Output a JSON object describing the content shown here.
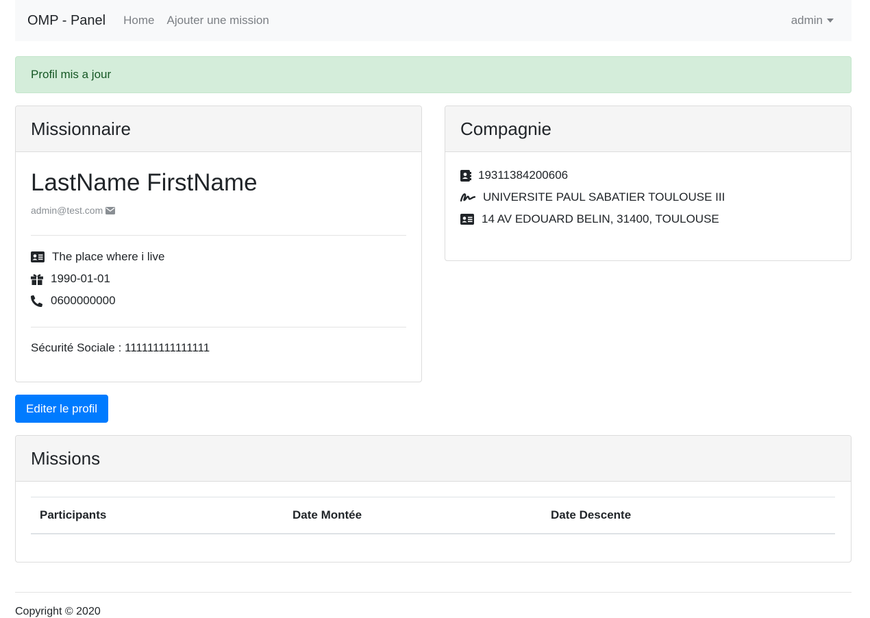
{
  "navbar": {
    "brand": "OMP - Panel",
    "links": [
      "Home",
      "Ajouter une mission"
    ],
    "user": "admin"
  },
  "alert": {
    "text": "Profil mis a jour",
    "color": "#d4edda"
  },
  "missionnaire": {
    "title": "Missionnaire",
    "name": "LastName FirstName",
    "email": "admin@test.com",
    "address": "The place where i live",
    "birthdate": "1990-01-01",
    "phone": "0600000000",
    "secu_label": "Sécurité Sociale : ",
    "secu_value": "111111111111111",
    "icons": [
      "envelope-icon",
      "id-card-icon",
      "gift-icon",
      "phone-icon"
    ]
  },
  "compagnie": {
    "title": "Compagnie",
    "siret": "19311384200606",
    "name": "UNIVERSITE PAUL SABATIER TOULOUSE III",
    "address": "14 AV EDOUARD BELIN, 31400, TOULOUSE",
    "icons": [
      "address-book-icon",
      "signature-icon",
      "id-card-icon"
    ]
  },
  "edit_button": {
    "label": "Editer le profil",
    "color": "#007bff"
  },
  "missions": {
    "title": "Missions",
    "columns": [
      "Participants",
      "Date Montée",
      "Date Descente"
    ],
    "rows": []
  },
  "footer": {
    "text": "Copyright © 2020"
  }
}
